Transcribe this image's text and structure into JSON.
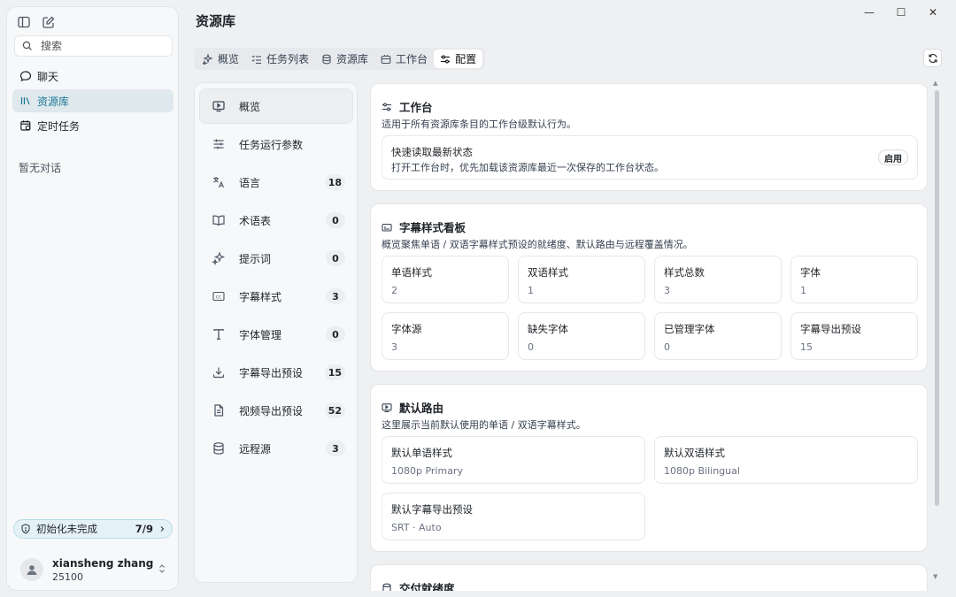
{
  "window": {
    "minimize": "—",
    "maximize": "☐",
    "close": "✕"
  },
  "sidebar": {
    "search_placeholder": "搜索",
    "nav": [
      {
        "label": "聊天",
        "icon": "chat-bubble-icon"
      },
      {
        "label": "资源库",
        "icon": "library-icon",
        "active": true
      },
      {
        "label": "定时任务",
        "icon": "calendar-clock-icon"
      }
    ],
    "empty_conversations": "暂无对话",
    "init_status": {
      "label": "初始化未完成",
      "count": "7/9"
    },
    "user": {
      "name": "xiansheng zhang",
      "id": "25100"
    }
  },
  "main": {
    "title": "资源库",
    "tabs": [
      {
        "label": "概览",
        "icon": "sparkle-icon"
      },
      {
        "label": "任务列表",
        "icon": "list-icon"
      },
      {
        "label": "资源库",
        "icon": "database-icon"
      },
      {
        "label": "工作台",
        "icon": "workbench-icon"
      },
      {
        "label": "配置",
        "icon": "sliders-icon",
        "active": true
      }
    ]
  },
  "left_panel": {
    "items": [
      {
        "label": "概览",
        "icon": "monitor-icon",
        "active": true,
        "badge": ""
      },
      {
        "label": "任务运行参数",
        "icon": "sliders-icon",
        "badge": ""
      },
      {
        "label": "语言",
        "icon": "translate-icon",
        "badge": "18"
      },
      {
        "label": "术语表",
        "icon": "book-icon",
        "badge": "0"
      },
      {
        "label": "提示词",
        "icon": "sparkle-icon",
        "badge": "0"
      },
      {
        "label": "字幕样式",
        "icon": "subtitle-icon",
        "badge": "3"
      },
      {
        "label": "字体管理",
        "icon": "type-icon",
        "badge": "0"
      },
      {
        "label": "字幕导出预设",
        "icon": "download-icon",
        "badge": "15"
      },
      {
        "label": "视频导出预设",
        "icon": "document-icon",
        "badge": "52"
      },
      {
        "label": "远程源",
        "icon": "database-icon",
        "badge": "3"
      }
    ]
  },
  "workbench": {
    "title": "工作台",
    "desc": "适用于所有资源库条目的工作台级默认行为。",
    "option_title": "快速读取最新状态",
    "option_desc": "打开工作台时，优先加载该资源库最近一次保存的工作台状态。",
    "option_button": "启用"
  },
  "subtitle_board": {
    "title": "字幕样式看板",
    "desc": "概览聚焦单语 / 双语字幕样式预设的就绪度、默认路由与远程覆盖情况。",
    "stats": [
      {
        "label": "单语样式",
        "value": "2"
      },
      {
        "label": "双语样式",
        "value": "1"
      },
      {
        "label": "样式总数",
        "value": "3"
      },
      {
        "label": "字体",
        "value": "1"
      },
      {
        "label": "字体源",
        "value": "3"
      },
      {
        "label": "缺失字体",
        "value": "0"
      },
      {
        "label": "已管理字体",
        "value": "0"
      },
      {
        "label": "字幕导出预设",
        "value": "15"
      }
    ]
  },
  "default_route": {
    "title": "默认路由",
    "desc": "这里展示当前默认使用的单语 / 双语字幕样式。",
    "items": [
      {
        "label": "默认单语样式",
        "value": "1080p Primary"
      },
      {
        "label": "默认双语样式",
        "value": "1080p Bilingual"
      },
      {
        "label": "默认字幕导出预设",
        "value": "SRT · Auto"
      }
    ]
  },
  "next_card": {
    "title": "交付就绪度"
  }
}
